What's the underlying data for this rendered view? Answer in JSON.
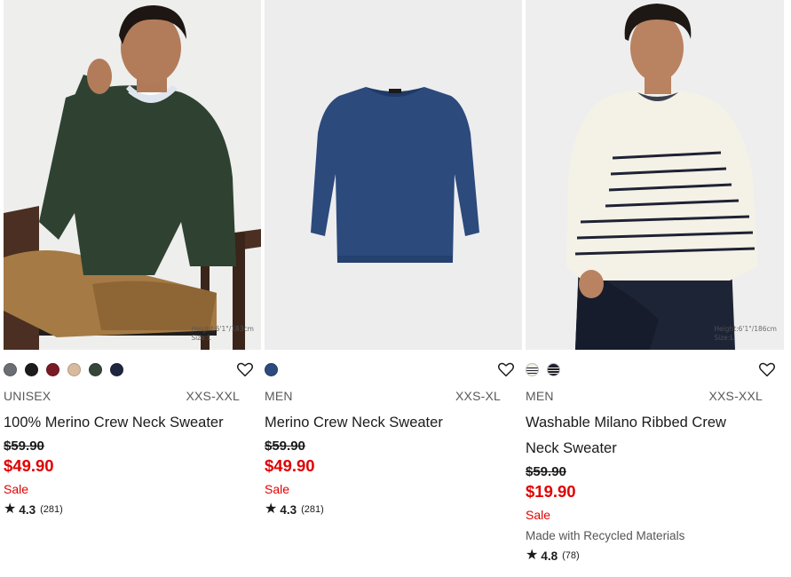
{
  "products": [
    {
      "gender": "UNISEX",
      "size_range": "XXS-XXL",
      "name": "100% Merino Crew Neck Sweater",
      "original_price": "$59.90",
      "sale_price": "$49.90",
      "sale_label": "Sale",
      "rating": "4.3",
      "review_count": "(281)",
      "image_note": "Height:6'1\"/183cm\nSize:L",
      "swatch_colors": [
        "#6b6e72",
        "#1c1c1c",
        "#7a1a24",
        "#d8bb9e",
        "#36463a",
        "#1f2640"
      ]
    },
    {
      "gender": "MEN",
      "size_range": "XXS-XL",
      "name": "Merino Crew Neck Sweater",
      "original_price": "$59.90",
      "sale_price": "$49.90",
      "sale_label": "Sale",
      "rating": "4.3",
      "review_count": "(281)",
      "swatch_colors": [
        "#2c4a7c"
      ]
    },
    {
      "gender": "MEN",
      "size_range": "XXS-XXL",
      "name": "Washable Milano Ribbed Crew Neck Sweater",
      "original_price": "$59.90",
      "sale_price": "$19.90",
      "sale_label": "Sale",
      "material_note": "Made with Recycled Materials",
      "rating": "4.8",
      "review_count": "(78)",
      "image_note": "Height:6'1\"/186cm\nSize:L",
      "swatch_colors": [
        "#f3f0e6",
        "#1b1f2e"
      ]
    }
  ],
  "icons": {
    "favorite": "heart-outline-icon",
    "rating": "star-icon"
  },
  "colors": {
    "sale_red": "#e00000"
  }
}
